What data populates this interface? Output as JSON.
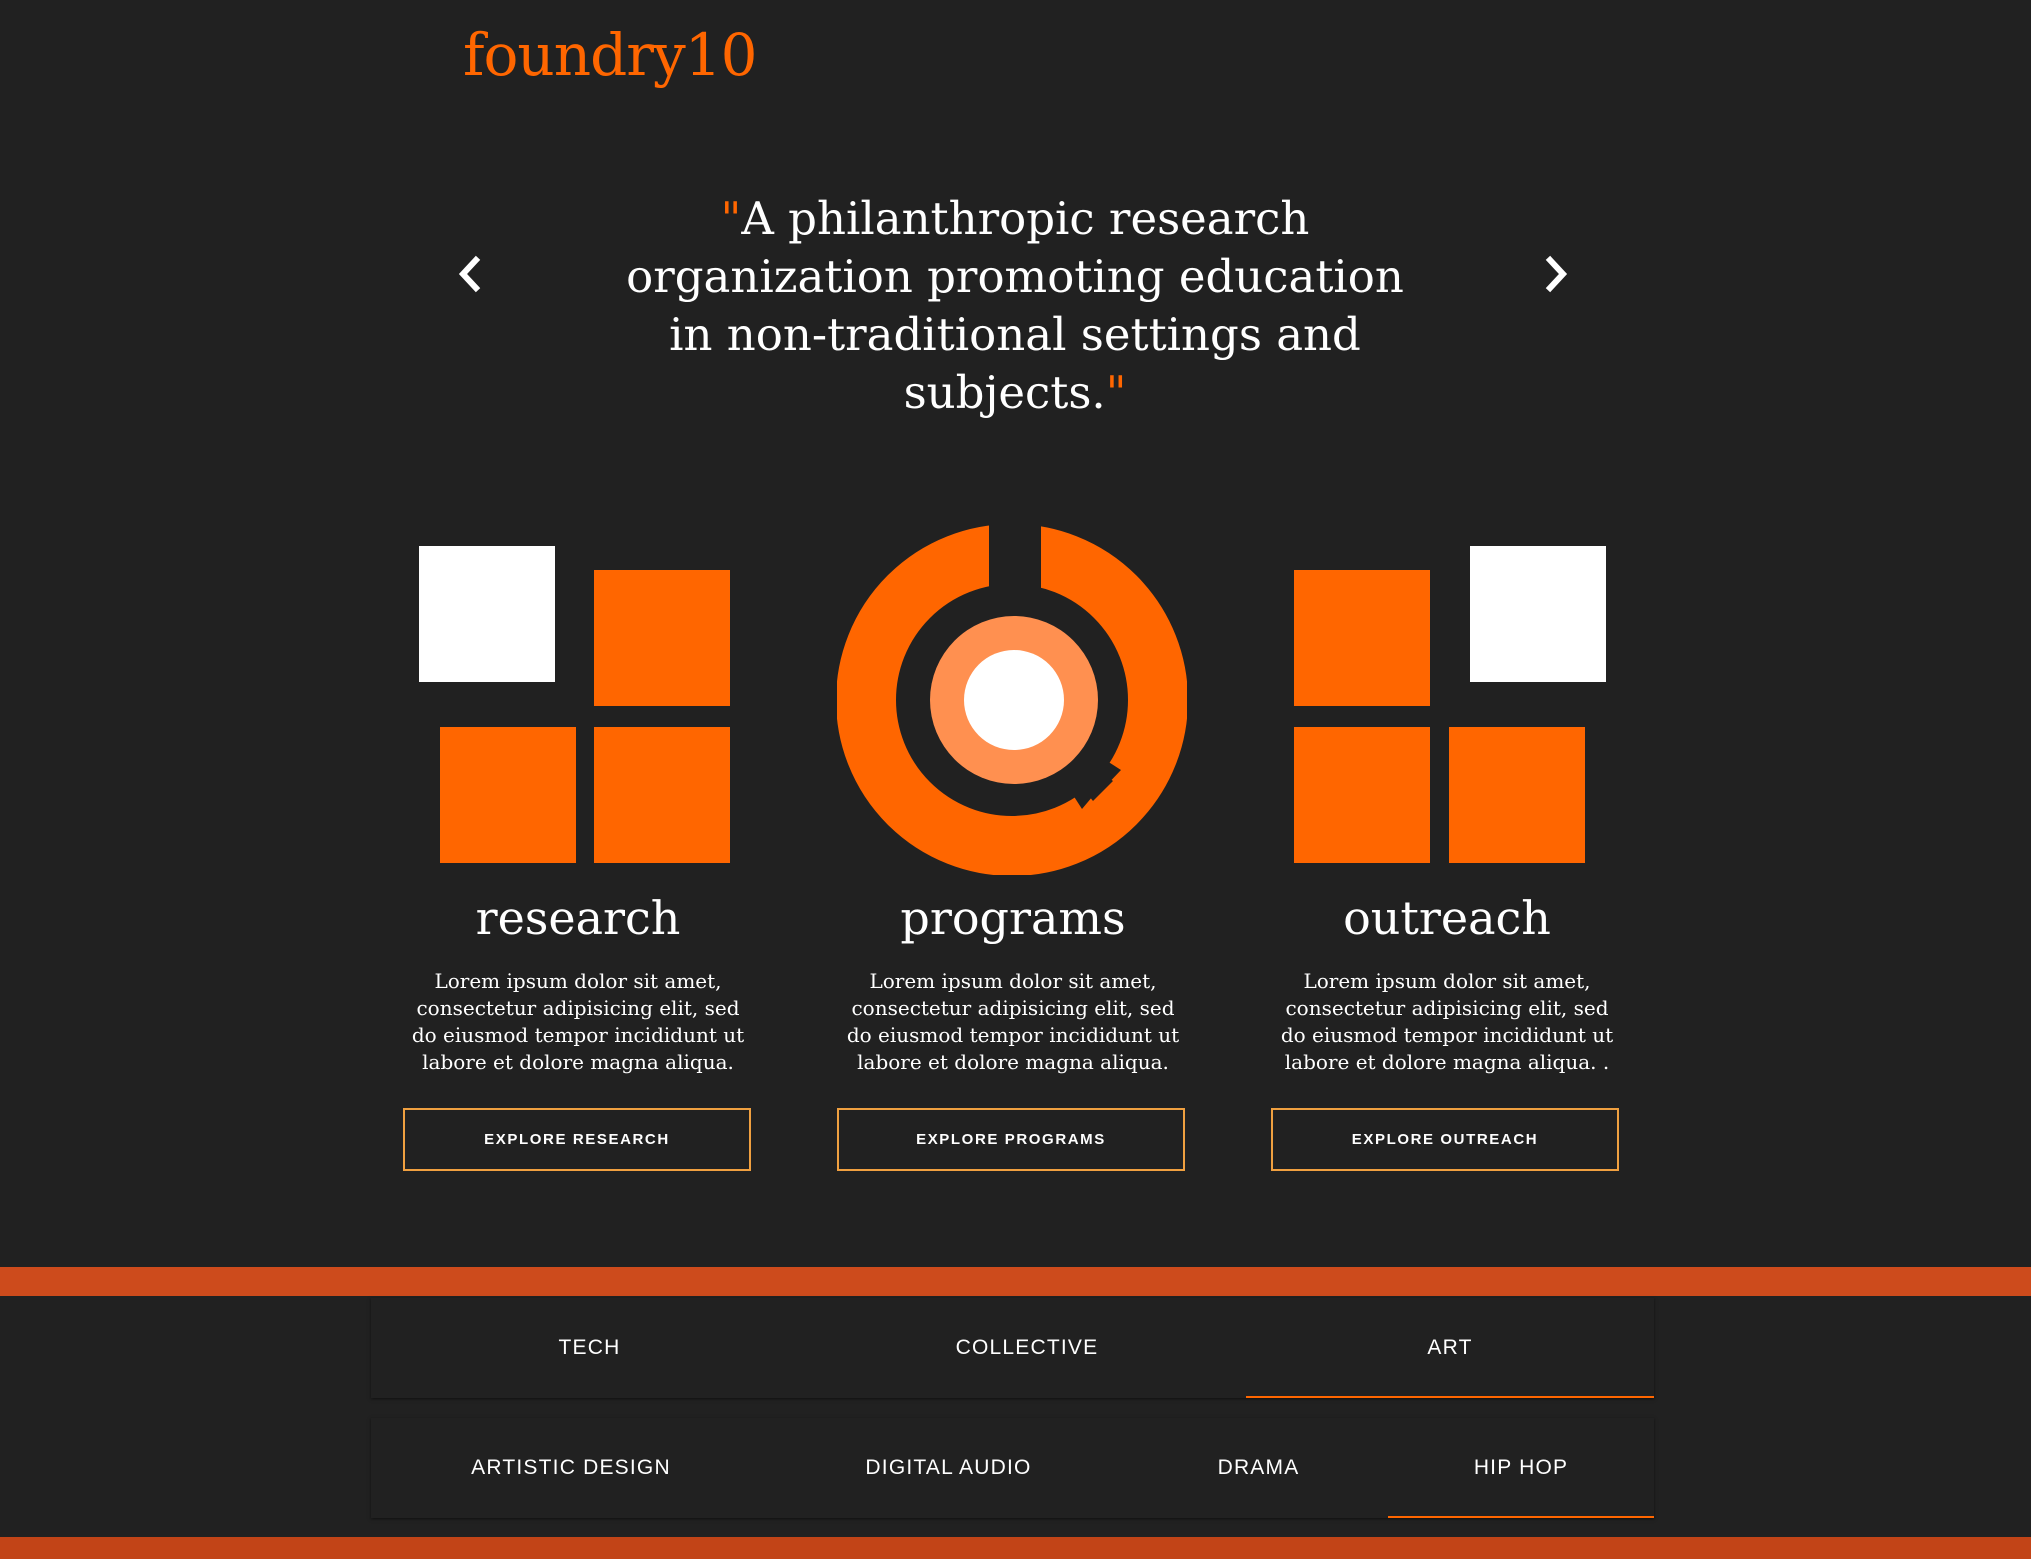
{
  "brand": {
    "logo": "foundry10",
    "accent_color": "#ff6600",
    "band_color": "#cd4b1c"
  },
  "hero": {
    "open_quote": "\"",
    "quote": "A philanthropic research organization promoting education in non-traditional settings and subjects.",
    "close_quote": "\"",
    "prev_icon": "chevron-left-icon",
    "next_icon": "chevron-right-icon"
  },
  "features": [
    {
      "title": "research",
      "description": "Lorem ipsum dolor sit amet, consectetur adipisicing elit, sed do eiusmod tempor incididunt ut labore et dolore magna aliqua.",
      "button": "EXPLORE RESEARCH",
      "icon": "research-squares-icon"
    },
    {
      "title": "programs",
      "description": "Lorem ipsum dolor sit amet, consectetur adipisicing elit, sed do eiusmod tempor incididunt ut labore et dolore magna aliqua.",
      "button": "EXPLORE PROGRAMS",
      "icon": "programs-target-icon"
    },
    {
      "title": "outreach",
      "description": "Lorem ipsum dolor sit amet, consectetur adipisicing elit, sed do eiusmod tempor incididunt ut labore et dolore magna aliqua. .",
      "button": "EXPLORE OUTREACH",
      "icon": "outreach-squares-icon"
    }
  ],
  "primary_tabs": [
    {
      "label": "TECH",
      "active": false
    },
    {
      "label": "COLLECTIVE",
      "active": false
    },
    {
      "label": "ART",
      "active": true
    }
  ],
  "secondary_tabs": [
    {
      "label": "ARTISTIC DESIGN",
      "active": false
    },
    {
      "label": "DIGITAL AUDIO",
      "active": false
    },
    {
      "label": "DRAMA",
      "active": false
    },
    {
      "label": "HIP HOP",
      "active": true
    }
  ]
}
